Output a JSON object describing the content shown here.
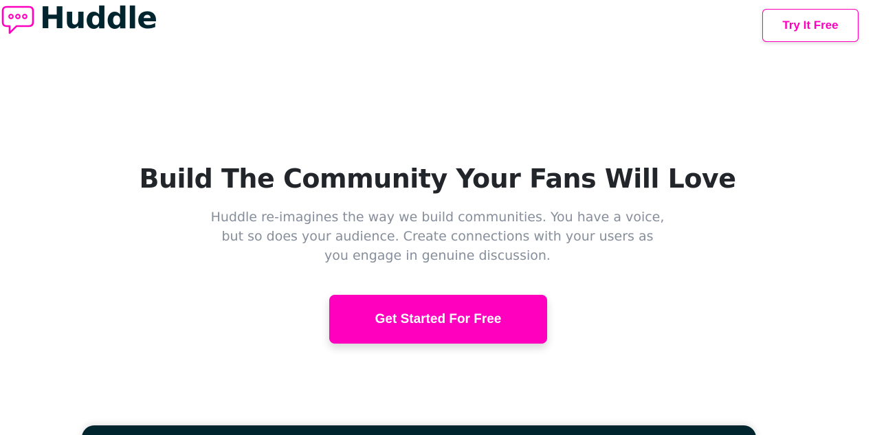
{
  "header": {
    "logo": {
      "icon": "chat-bubble-icon",
      "text": "Huddle"
    },
    "try_button_label": "Try It Free"
  },
  "hero": {
    "title": "Build The Community Your Fans Will Love",
    "subtitle_lines": [
      "Huddle re-imagines the way we build communities. You have a voice,",
      "but so does your audience. Create connections with your users as",
      "you engage in genuine discussion."
    ],
    "cta_label": "Get Started For Free"
  },
  "colors": {
    "brand_pink": "#ff00bf",
    "dark_navy": "#00252e",
    "title_text": "#22262b",
    "body_text": "#858e9a"
  }
}
